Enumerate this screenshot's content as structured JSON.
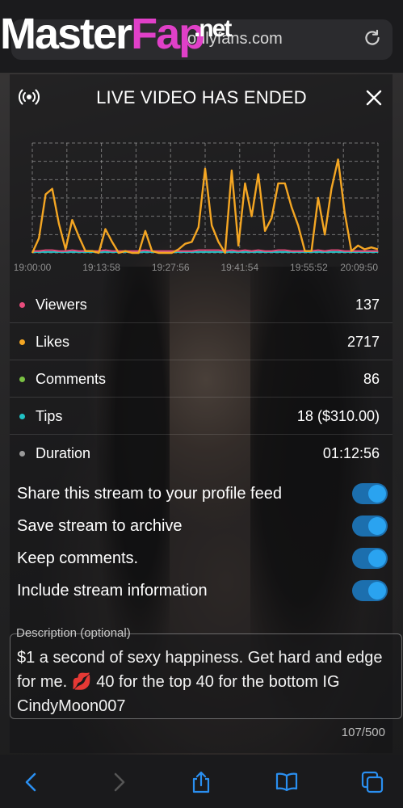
{
  "browser": {
    "url_text": "onlyfans.com",
    "watermark_part1": "Master",
    "watermark_part2": "Fap",
    "watermark_net": ".net"
  },
  "overlay": {
    "title": "LIVE VIDEO HAS ENDED"
  },
  "chart_data": {
    "type": "line",
    "x": [
      "19:00:00",
      "19:13:58",
      "19:27:56",
      "19:41:54",
      "19:55:52",
      "20:09:50"
    ],
    "ylim": [
      0,
      6
    ],
    "grid": true,
    "series": [
      {
        "color": "#f4a623",
        "values": [
          0,
          0.8,
          3.2,
          3.5,
          1.6,
          0.2,
          1.8,
          0.9,
          0.1,
          0.1,
          0,
          1.3,
          0.6,
          0,
          0.1,
          0,
          0,
          1.2,
          0.1,
          0,
          0,
          0,
          0.2,
          0.5,
          0.6,
          1.4,
          4.6,
          1.5,
          0.6,
          0,
          4.5,
          0.4,
          3.8,
          2.0,
          4.3,
          1.2,
          1.9,
          3.8,
          3.8,
          2.5,
          1.5,
          0.1,
          0.1,
          3.0,
          1.0,
          3.5,
          5.1,
          2.2,
          0.1,
          0.4,
          0.2,
          0.3,
          0.2
        ]
      },
      {
        "color": "#e84c7c",
        "values": [
          0.1,
          0.1,
          0.15,
          0.15,
          0.1,
          0.1,
          0.15,
          0.1,
          0.1,
          0.1,
          0.1,
          0.15,
          0.1,
          0.1,
          0.1,
          0.1,
          0.1,
          0.15,
          0.1,
          0.1,
          0.1,
          0.1,
          0.1,
          0.1,
          0.1,
          0.15,
          0.15,
          0.15,
          0.15,
          0.1,
          0.15,
          0.1,
          0.15,
          0.1,
          0.15,
          0.1,
          0.1,
          0.15,
          0.15,
          0.1,
          0.1,
          0.1,
          0.1,
          0.15,
          0.1,
          0.15,
          0.15,
          0.1,
          0.1,
          0.1,
          0.1,
          0.1,
          0.1
        ]
      },
      {
        "color": "#21c2c5",
        "values": [
          0.05,
          0.05,
          0.05,
          0.05,
          0.05,
          0.05,
          0.05,
          0.05,
          0.05,
          0.05,
          0.05,
          0.05,
          0.05,
          0.05,
          0.05,
          0.05,
          0.05,
          0.05,
          0.05,
          0.05,
          0.05,
          0.05,
          0.05,
          0.05,
          0.05,
          0.05,
          0.05,
          0.05,
          0.05,
          0.05,
          0.05,
          0.05,
          0.05,
          0.05,
          0.05,
          0.05,
          0.05,
          0.05,
          0.05,
          0.05,
          0.05,
          0.05,
          0.05,
          0.05,
          0.05,
          0.05,
          0.05,
          0.05,
          0.05,
          0.05,
          0.05,
          0.05,
          0.05
        ]
      }
    ]
  },
  "stats": [
    {
      "label": "Viewers",
      "value": "137",
      "color": "#e84c7c"
    },
    {
      "label": "Likes",
      "value": "2717",
      "color": "#f4a623"
    },
    {
      "label": "Comments",
      "value": "86",
      "color": "#7ac143"
    },
    {
      "label": "Tips",
      "value": "18 ($310.00)",
      "color": "#21c2c5"
    },
    {
      "label": "Duration",
      "value": "01:12:56",
      "color": "#9a9a9a"
    }
  ],
  "toggles": [
    {
      "label": "Share this stream to your profile feed",
      "on": true
    },
    {
      "label": "Save stream to archive",
      "on": true
    },
    {
      "label": "Keep comments.",
      "on": true
    },
    {
      "label": "Include stream information",
      "on": true
    }
  ],
  "description": {
    "label": "Description (optional)",
    "text": "$1 a second of sexy happiness. Get hard and edge for me. 💋 40 for the top 40 for the bottom IG CindyMoon007",
    "counter": "107/500"
  },
  "accent_color": "#2aa3f0",
  "icons": [
    "live-broadcast-icon",
    "close-icon",
    "reload-icon",
    "back-icon",
    "forward-icon",
    "share-icon",
    "bookmarks-icon",
    "tabs-icon"
  ]
}
